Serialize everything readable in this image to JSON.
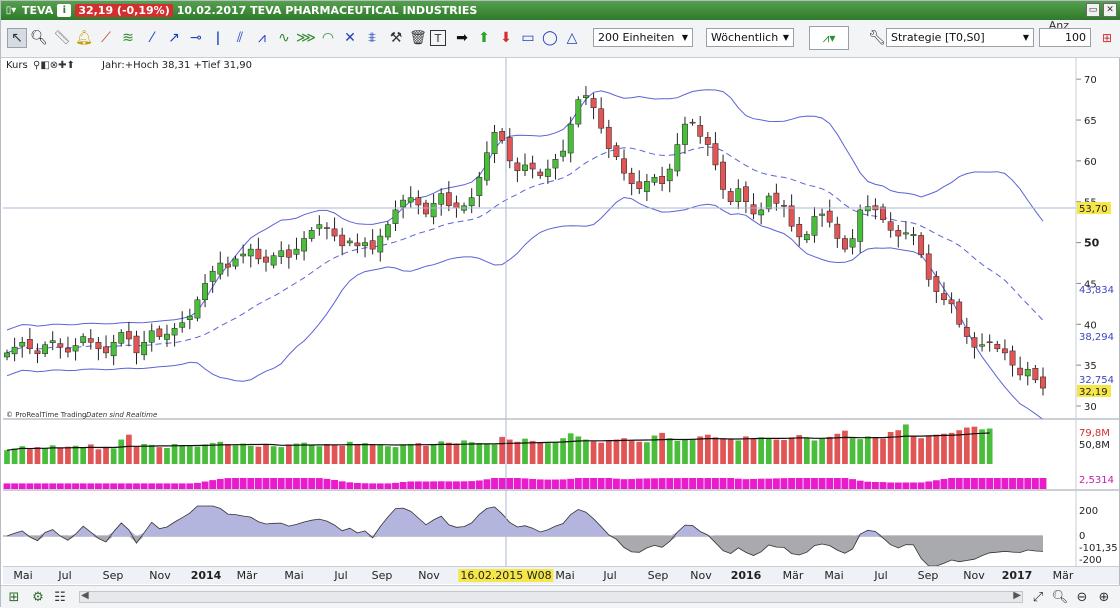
{
  "titlebar": {
    "symbol": "TEVA",
    "price_change": "32,19 (-0,19%)",
    "date_name": "10.02.2017 TEVA PHARMACEUTICAL INDUSTRIES"
  },
  "toolbar": {
    "units_select": "200 Einheiten",
    "period_select": "Wöchentlich",
    "strategy_select": "Strategie [T0,S0]",
    "anz_label": "Anz",
    "anz_value": "100"
  },
  "chart": {
    "legend_text": "Jahr:+Hoch 38,31 +Tief 31,90",
    "legend_prefix": "Kurs",
    "copyright": "© ProRealTime Trading",
    "copyright_realtime": "Daten sind Realtime",
    "crosshair_price": "53,70",
    "last_price": "32,19",
    "bb_upper_label": "43,834",
    "bb_mid_label": "38,294",
    "bb_lower_label": "32,754",
    "volume_label": "79,8M",
    "volume_ma_label": "50,8M",
    "ind2_label": "2,5314",
    "cci_label": "-101,35",
    "cursor_date": "16.02.2015 W08",
    "price_ticks": [
      "70",
      "65",
      "60",
      "55",
      "50",
      "45",
      "40",
      "35",
      "30"
    ],
    "cci_ticks": [
      "200",
      "0",
      "-200"
    ],
    "x_labels": [
      {
        "t": "Mai",
        "year": false
      },
      {
        "t": "Jul",
        "year": false
      },
      {
        "t": "Sep",
        "year": false
      },
      {
        "t": "Nov",
        "year": false
      },
      {
        "t": "2014",
        "year": true
      },
      {
        "t": "Mär",
        "year": false
      },
      {
        "t": "Mai",
        "year": false
      },
      {
        "t": "Jul",
        "year": false
      },
      {
        "t": "Sep",
        "year": false
      },
      {
        "t": "Nov",
        "year": false
      },
      {
        "t": "Mai",
        "year": false
      },
      {
        "t": "Jul",
        "year": false
      },
      {
        "t": "Sep",
        "year": false
      },
      {
        "t": "Nov",
        "year": false
      },
      {
        "t": "2016",
        "year": true
      },
      {
        "t": "Mär",
        "year": false
      },
      {
        "t": "Mai",
        "year": false
      },
      {
        "t": "Jul",
        "year": false
      },
      {
        "t": "Sep",
        "year": false
      },
      {
        "t": "Nov",
        "year": false
      },
      {
        "t": "2017",
        "year": true
      },
      {
        "t": "Mär",
        "year": false
      }
    ]
  },
  "chart_data": {
    "type": "candlestick",
    "ylim": [
      30,
      71
    ],
    "price_path": [
      36.5,
      37.2,
      37.8,
      37,
      36.4,
      37.5,
      38,
      37.2,
      36.6,
      37.4,
      38.5,
      37.8,
      37,
      36.5,
      37.8,
      39,
      38.2,
      36.5,
      37.8,
      39.2,
      38.5,
      38.8,
      39.5,
      40.2,
      41,
      43,
      45,
      46.5,
      47.5,
      47,
      48,
      48.6,
      49.2,
      48,
      47.6,
      48.4,
      49,
      48.2,
      49.2,
      50.5,
      51.5,
      52.2,
      51.8,
      50.8,
      49.6,
      50.2,
      49.6,
      50,
      49.2,
      50.8,
      52.2,
      54,
      55.2,
      55.5,
      54.6,
      53.5,
      54.8,
      56,
      54.5,
      54.2,
      54.5,
      55.5,
      58,
      61,
      63.5,
      62.5,
      60,
      58.8,
      59.5,
      59,
      58.2,
      59,
      60.2,
      61.2,
      64.5,
      67.5,
      68,
      66.5,
      64,
      61.5,
      60.5,
      58.5,
      57.2,
      56.6,
      57.5,
      58,
      57.2,
      59,
      62,
      64.5,
      64.7,
      63,
      62,
      59.5,
      56.5,
      55,
      56.6,
      55,
      53.5,
      54,
      55.7,
      54.8,
      54.5,
      52,
      50.7,
      51,
      53.2,
      53.5,
      52.5,
      50.5,
      49.2,
      50.5,
      54,
      54.4,
      54,
      52.8,
      51.5,
      50.8,
      51.2,
      51,
      48.5,
      45.5,
      44,
      43,
      42.5,
      40,
      38.5,
      37.2,
      37.5,
      37.8,
      37,
      36.5,
      35,
      33.8,
      34.5,
      33.2,
      32.19
    ],
    "volume_path": [
      31,
      35,
      40,
      33,
      38,
      35,
      42,
      36,
      39,
      41,
      37,
      44,
      33,
      38,
      35,
      55,
      66,
      40,
      45,
      43,
      38,
      36,
      45,
      42,
      40,
      39,
      44,
      47,
      50,
      45,
      42,
      46,
      41,
      39,
      43,
      40,
      38,
      44,
      46,
      48,
      42,
      40,
      45,
      43,
      41,
      50,
      44,
      47,
      45,
      43,
      40,
      38,
      42,
      45,
      47,
      41,
      44,
      51,
      48,
      46,
      53,
      49,
      47,
      45,
      44,
      61,
      55,
      50,
      57,
      52,
      48,
      47,
      49,
      58,
      69,
      62,
      55,
      51,
      48,
      52,
      55,
      58,
      54,
      50,
      49,
      64,
      70,
      58,
      52,
      54,
      56,
      62,
      66,
      60,
      58,
      55,
      53,
      62,
      56,
      60,
      58,
      55,
      54,
      60,
      65,
      59,
      53,
      57,
      61,
      68,
      75,
      58,
      56,
      62,
      60,
      57,
      72,
      76,
      89,
      62,
      58,
      64,
      66,
      68,
      70,
      76,
      82,
      84,
      78,
      79.8
    ]
  }
}
